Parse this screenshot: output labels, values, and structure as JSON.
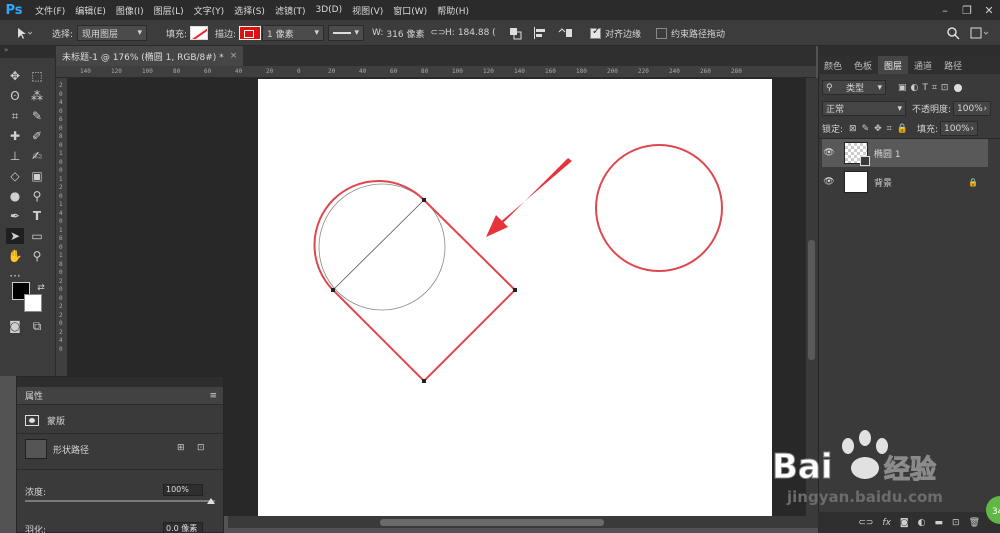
{
  "app": {
    "logo": "Ps"
  },
  "menu": [
    "文件(F)",
    "编辑(E)",
    "图像(I)",
    "图层(L)",
    "文字(Y)",
    "选择(S)",
    "滤镜(T)",
    "3D(D)",
    "视图(V)",
    "窗口(W)",
    "帮助(H)"
  ],
  "options": {
    "select_label": "选择:",
    "select_value": "现用图层",
    "fill_label": "填充:",
    "stroke_label": "描边:",
    "stroke_width": "1 像素",
    "w_label": "W:",
    "w_value": "316 像素",
    "h_label": "H:",
    "h_value": "184.88 (",
    "align_edges_label": "对齐边缘",
    "align_edges_checked": true,
    "constrain_label": "约束路径拖动",
    "constrain_checked": false
  },
  "document_tab": {
    "title": "未标题-1 @ 176% (椭圆 1, RGB/8#) *",
    "close": "×"
  },
  "ruler_h": [
    "140",
    "120",
    "100",
    "80",
    "60",
    "40",
    "20",
    "0",
    "20",
    "40",
    "60",
    "80",
    "100",
    "120",
    "140",
    "160",
    "180",
    "200",
    "220",
    "240",
    "260",
    "280"
  ],
  "ruler_v": [
    "2",
    "0",
    "4",
    "0",
    "6",
    "0",
    "8",
    "0",
    "1",
    "0",
    "0",
    "1",
    "2",
    "0",
    "1",
    "4",
    "0",
    "1",
    "6",
    "0",
    "1",
    "8",
    "0",
    "2",
    "0",
    "0",
    "2",
    "2",
    "0",
    "2",
    "4",
    "0"
  ],
  "properties": {
    "title": "属性",
    "mask_label": "蒙版",
    "shape_path_label": "形状路径",
    "density_label": "浓度:",
    "density_value": "100%",
    "density_fraction": 1.0,
    "feather_label": "羽化:",
    "feather_value": "0.0 像素"
  },
  "right_panel": {
    "tabs": [
      "颜色",
      "色板",
      "图层",
      "通道",
      "路径"
    ],
    "active_tab": "图层",
    "kind_label": "类型",
    "blend_mode": "正常",
    "opacity_label": "不透明度:",
    "opacity_value": "100%",
    "lock_label": "锁定:",
    "fill_label": "填充:",
    "fill_value": "100%",
    "layers": [
      {
        "name": "椭圆 1",
        "selected": true
      },
      {
        "name": "背景",
        "selected": false
      }
    ]
  },
  "watermark": {
    "brand": "Bai",
    "brand2": "经验",
    "url": "jingyan.baidu.com",
    "badge": "34"
  },
  "colors": {
    "accent": "#31a8ff",
    "shape_stroke": "#e0474c",
    "arrow": "#e8333a"
  }
}
